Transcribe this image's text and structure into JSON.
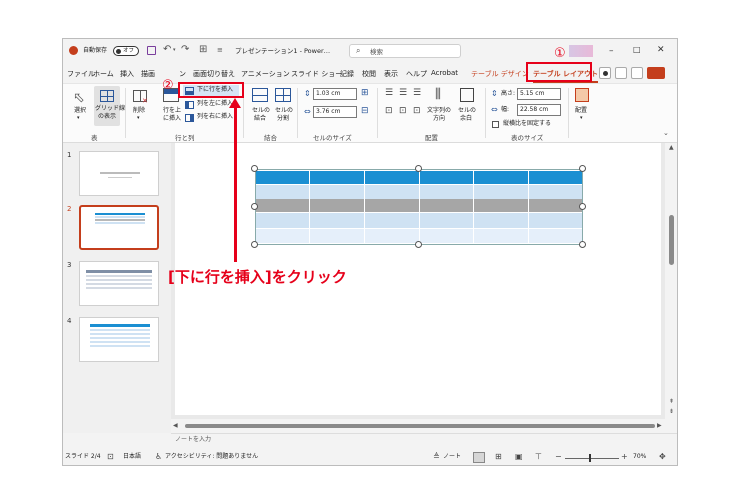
{
  "titlebar": {
    "autosave_label": "自動保存",
    "autosave_state": "オフ",
    "presentation_title": "プレゼンテーション1 - Power…",
    "search_placeholder": "検索"
  },
  "menu": [
    "ファイル",
    "ホーム",
    "挿入",
    "描画",
    "ン",
    "画面切り替え",
    "アニメーション",
    "スライド ショー",
    "記録",
    "校閲",
    "表示",
    "ヘルプ",
    "Acrobat",
    "テーブル デザイン",
    "テーブル レイアウト"
  ],
  "ribbon": {
    "select": "選択",
    "gridlines": [
      "グリッド線",
      "の表示"
    ],
    "delete": "削除",
    "insert_above": [
      "行を上",
      "に挿入"
    ],
    "insert_below": "下に行を挿入",
    "insert_left": "列を左に挿入",
    "insert_right": "列を右に挿入",
    "merge": [
      "セルの",
      "結合"
    ],
    "split": [
      "セルの",
      "分割"
    ],
    "row_height": "1.03 cm",
    "col_width": "3.76 cm",
    "text_direction": [
      "文字列の",
      "方向"
    ],
    "cell_margin": [
      "セルの",
      "余白"
    ],
    "table_height_label": "高さ:",
    "table_height": "5.15 cm",
    "table_width_label": "幅:",
    "table_width": "22.58 cm",
    "lock_ratio": "縦横比を固定する",
    "arrange": "配置",
    "groups": {
      "table": "表",
      "rows_cols": "行と列",
      "merge": "結合",
      "cell_size": "セルのサイズ",
      "alignment": "配置",
      "table_size": "表のサイズ"
    }
  },
  "slides": [
    "1",
    "2",
    "3",
    "4"
  ],
  "notes_placeholder": "ノートを入力",
  "status": {
    "slide_pos": "スライド 2/4",
    "language": "日本語",
    "accessibility": "アクセシビリティ: 問題ありません",
    "notes": "ノート",
    "zoom": "70%"
  },
  "annotation": {
    "step1": "①",
    "step2": "②",
    "callout": "[下に行を挿入]をクリック",
    "color": "#e6001a"
  }
}
